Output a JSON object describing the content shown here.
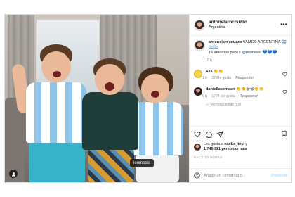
{
  "header": {
    "username": "antonelaroccuzzo",
    "location": "Argentina",
    "more_icon": "more-dots-icon"
  },
  "photo": {
    "tag_label": "leomessi",
    "user_icon": "person-icon"
  },
  "caption": {
    "username": "antonelaroccuzzo",
    "text": "VAMOS ARGENTINA 🇦🇷🇦🇷🇦🇷",
    "line2": "Te amamos papi!!!",
    "mention": "@leomessi",
    "trail": " 💙💙💙",
    "time": "10 h"
  },
  "comments": [
    {
      "username": "433",
      "text": " 👏👏",
      "time": "1 h",
      "likes": "27 Me gusta",
      "reply": "Responder"
    },
    {
      "username": "daniellasemaan",
      "text": " 👏👏😍😍👏👏",
      "time": "9 h",
      "likes": "1778 Me gusta",
      "reply": "Responder"
    }
  ],
  "view_replies": "— Ver respuestas (85)",
  "actions": {
    "like_icon": "heart-icon",
    "comment_icon": "comment-icon",
    "share_icon": "share-icon",
    "save_icon": "bookmark-icon"
  },
  "likes": {
    "prefix": "Les gusta a ",
    "user": "nacho_tosi",
    "middle": " y",
    "count": "1.746.921 personas más"
  },
  "post_time": "HACE 10 HORAS",
  "add_comment": {
    "placeholder": "Añade un comentario...",
    "publish_label": "Publicar",
    "emoji_icon": "emoji-icon"
  },
  "colors": {
    "link": "#00376b",
    "muted": "#8e8e8e",
    "publish_disabled": "#b2dffc",
    "border": "#dbdbdb"
  }
}
